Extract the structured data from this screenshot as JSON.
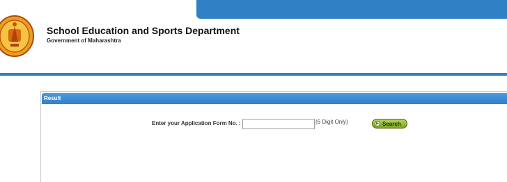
{
  "header": {
    "title": "School Education and Sports Department",
    "subtitle": "Government of Maharashtra",
    "emblem_icon": "maharashtra-seal-icon",
    "accent_color": "#2f80c4"
  },
  "panel": {
    "title": "Result"
  },
  "form": {
    "label": "Enter your Application Form No. :",
    "input_value": "",
    "input_placeholder": "",
    "hint": "(6 Digit Only)",
    "search_label": "Search",
    "search_icon": "arrow-right-circle-icon",
    "button_color": "#8bb52b"
  }
}
